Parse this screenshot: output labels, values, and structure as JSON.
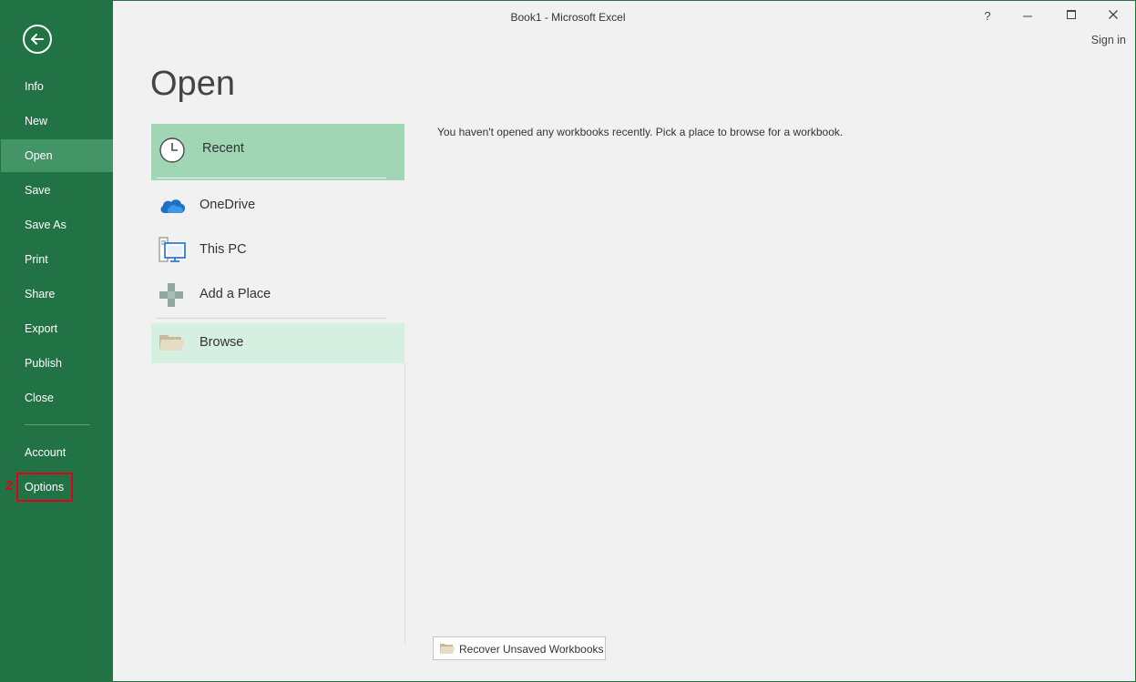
{
  "window": {
    "title": "Book1 - Microsoft Excel",
    "help_glyph": "?",
    "minimize_glyph": "—",
    "maximize_glyph": "◻",
    "close_glyph": "✕",
    "sign_in": "Sign in"
  },
  "sidebar": {
    "back_icon": "back-arrow-icon",
    "items": [
      {
        "label": "Info"
      },
      {
        "label": "New"
      },
      {
        "label": "Open",
        "active": true
      },
      {
        "label": "Save"
      },
      {
        "label": "Save As"
      },
      {
        "label": "Print"
      },
      {
        "label": "Share"
      },
      {
        "label": "Export"
      },
      {
        "label": "Publish"
      },
      {
        "label": "Close"
      },
      {
        "label": "Account"
      },
      {
        "label": "Options",
        "highlighted": true
      }
    ],
    "annotation_number": "2"
  },
  "main": {
    "heading": "Open",
    "places": {
      "recent": "Recent",
      "onedrive": "OneDrive",
      "this_pc": "This PC",
      "add_place": "Add a Place",
      "browse": "Browse"
    },
    "empty_message": "You haven't opened any workbooks recently. Pick a place to browse for a workbook.",
    "recover_button": "Recover Unsaved Workbooks"
  },
  "colors": {
    "sidebar_bg": "#217346",
    "sidebar_active": "#439467",
    "recent_bg": "#a0d6b4",
    "browse_bg": "#d5f0e0",
    "highlight": "#e0001b"
  }
}
